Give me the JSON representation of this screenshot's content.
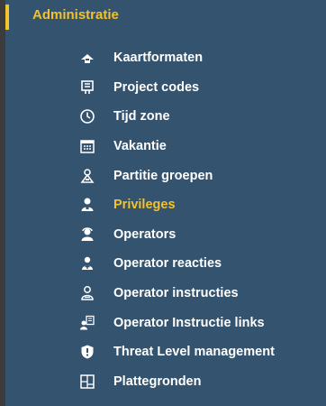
{
  "section": {
    "title": "Administratie"
  },
  "menu": {
    "items": [
      {
        "label": "Kaartformaten",
        "icon": "map-format-icon"
      },
      {
        "label": "Project codes",
        "icon": "project-codes-icon"
      },
      {
        "label": "Tijd zone",
        "icon": "time-zone-icon"
      },
      {
        "label": "Vakantie",
        "icon": "holiday-calendar-icon"
      },
      {
        "label": "Partitie groepen",
        "icon": "partition-groups-icon"
      },
      {
        "label": "Privileges",
        "icon": "privileges-icon",
        "active": true
      },
      {
        "label": "Operators",
        "icon": "operators-icon"
      },
      {
        "label": "Operator reacties",
        "icon": "operator-reactions-icon"
      },
      {
        "label": "Operator instructies",
        "icon": "operator-instructions-icon"
      },
      {
        "label": "Operator Instructie links",
        "icon": "operator-instruction-links-icon"
      },
      {
        "label": "Threat Level management",
        "icon": "threat-level-shield-icon"
      },
      {
        "label": "Plattegronden",
        "icon": "floor-plans-icon"
      }
    ]
  },
  "colors": {
    "background": "#33536f",
    "accent": "#f2c230",
    "text": "#ffffff",
    "left_border": "#3c3c3c"
  }
}
